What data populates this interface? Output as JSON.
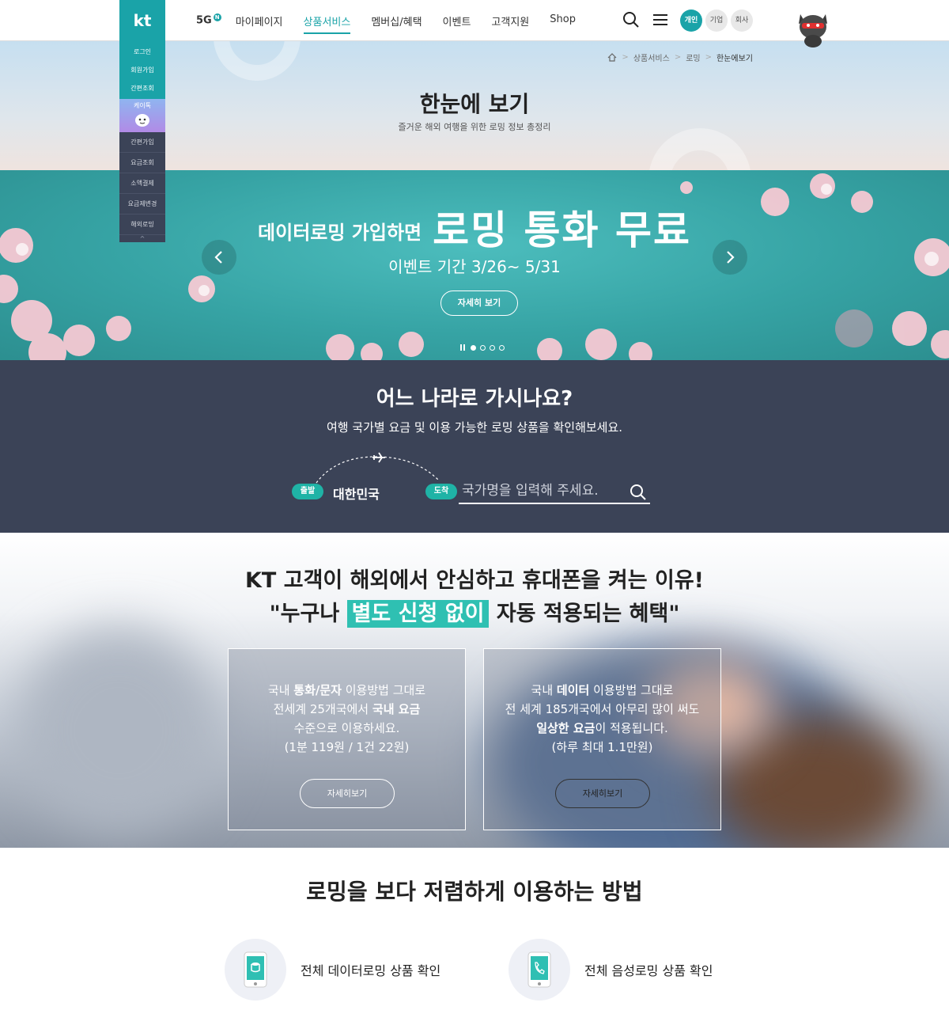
{
  "brand": {
    "logo": "kt",
    "accent": "#1aa3a8",
    "navy": "#3b4357"
  },
  "gnb": {
    "items": [
      "5G",
      "마이페이지",
      "상품서비스",
      "멤버십/혜택",
      "이벤트",
      "고객지원",
      "Shop"
    ],
    "badge": "N",
    "active_index": 2
  },
  "header_tools": {
    "icons": [
      "search-icon",
      "menu-icon"
    ],
    "segments": [
      "개인",
      "기업",
      "회사"
    ]
  },
  "quick_menu": {
    "top_items": [
      "로그인",
      "회원가입",
      "간편조회"
    ],
    "kaitok": "케이톡",
    "bottom_items": [
      "간편가입",
      "요금조회",
      "소액결제",
      "요금제변경",
      "해외로밍"
    ],
    "up": "^"
  },
  "breadcrumb": [
    "상품서비스",
    "로밍",
    "한눈에보기"
  ],
  "page": {
    "title": "한눈에 보기",
    "subtitle": "즐거운 해외 여행을 위한 로밍 정보 총정리"
  },
  "banner": {
    "headline_small": "데이터로밍 가입하면",
    "headline_big": "로밍 통화 무료",
    "period": "이벤트 기간 3/26~ 5/31",
    "button": "자세히 보기",
    "slides": 4,
    "current_slide": 1
  },
  "country_search": {
    "title": "어느 나라로 가시나요?",
    "desc": "여행 국가별 요금 및 이용 가능한 로밍 상품을 확인해보세요.",
    "depart_tag": "출발",
    "depart_value": "대한민국",
    "arrive_tag": "도착",
    "placeholder": "국가명을 입력해 주세요."
  },
  "benefits": {
    "title_line1": "KT 고객이 해외에서 안심하고 휴대폰을 켜는 이유!",
    "title_quote_open": "\"누구나",
    "title_highlight": "별도 신청 없이",
    "title_quote_close": "자동 적용되는 혜택\"",
    "card1": {
      "l1a": "국내 ",
      "l1b": "통화/문자",
      "l1c": " 이용방법 그대로",
      "l2a": "전세계 25개국에서 ",
      "l2b": "국내 요금",
      "l3": "수준으로 이용하세요.",
      "l4": "(1분 119원 / 1건 22원)",
      "button": "자세히보기"
    },
    "card2": {
      "l1a": "국내 ",
      "l1b": "데이터",
      "l1c": " 이용방법 그대로",
      "l2": "전 세계 185개국에서 아무리 많이 써도",
      "l3a": "일상한 요금",
      "l3b": "이 적용됩니다.",
      "l4": "(하루 최대 1.1만원)",
      "button": "자세히보기"
    }
  },
  "cheaper": {
    "title": "로밍을 보다 저렴하게 이용하는 방법",
    "items": [
      "전체 데이터로밍 상품 확인",
      "전체 음성로밍 상품 확인"
    ]
  }
}
